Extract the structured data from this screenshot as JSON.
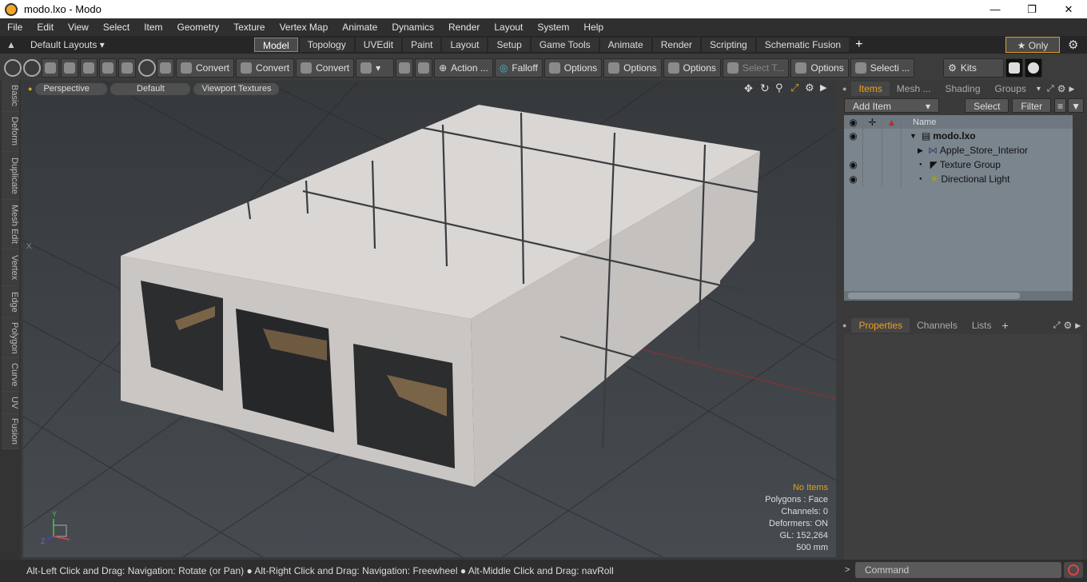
{
  "window": {
    "title": "modo.lxo - Modo"
  },
  "menu": [
    "File",
    "Edit",
    "View",
    "Select",
    "Item",
    "Geometry",
    "Texture",
    "Vertex Map",
    "Animate",
    "Dynamics",
    "Render",
    "Layout",
    "System",
    "Help"
  ],
  "layouts": {
    "label": "Default Layouts ▾",
    "tabs": [
      "Model",
      "Topology",
      "UVEdit",
      "Paint",
      "Layout",
      "Setup",
      "Game Tools",
      "Animate",
      "Render",
      "Scripting",
      "Schematic Fusion"
    ],
    "active": "Model",
    "only": "★  Only"
  },
  "toolbar": {
    "convert1": "Convert",
    "convert2": "Convert",
    "convert3": "Convert",
    "action": "Action  ...",
    "falloff": "Falloff",
    "options1": "Options",
    "options2": "Options",
    "options3": "Options",
    "select_t": "Select T...",
    "options4": "Options",
    "selecti": "Selecti ...",
    "kits": "Kits"
  },
  "left_tabs": [
    "Basic",
    "Deform",
    "Duplicate",
    "Mesh Edit",
    "Vertex",
    "Edge",
    "Polygon",
    "Curve",
    "UV",
    "Fusion"
  ],
  "viewport": {
    "buttons": [
      "Perspective",
      "Default",
      "Viewport Textures"
    ],
    "stats": {
      "no_items": "No Items",
      "polygons": "Polygons : Face",
      "channels": "Channels: 0",
      "deformers": "Deformers: ON",
      "gl": "GL: 152,264",
      "scale": "500 mm"
    },
    "axis_x": "X",
    "axis_y": "Y",
    "axis_z": "Z"
  },
  "items_panel": {
    "tabs": [
      "Items",
      "Mesh ...",
      "Shading",
      "Groups"
    ],
    "active_tab": "Items",
    "add_item": "Add Item",
    "select": "Select",
    "filter": "Filter",
    "col_name": "Name",
    "rows": [
      {
        "name": "modo.lxo",
        "indent": 0
      },
      {
        "name": "Apple_Store_Interior",
        "indent": 1
      },
      {
        "name": "Texture Group",
        "indent": 1
      },
      {
        "name": "Directional Light",
        "indent": 1
      }
    ]
  },
  "props_panel": {
    "tabs": [
      "Properties",
      "Channels",
      "Lists"
    ],
    "active_tab": "Properties"
  },
  "status": {
    "hint": "Alt-Left Click and Drag: Navigation: Rotate (or Pan) ● Alt-Right Click and Drag: Navigation: Freewheel ● Alt-Middle Click and Drag: navRoll",
    "command_placeholder": "Command"
  }
}
